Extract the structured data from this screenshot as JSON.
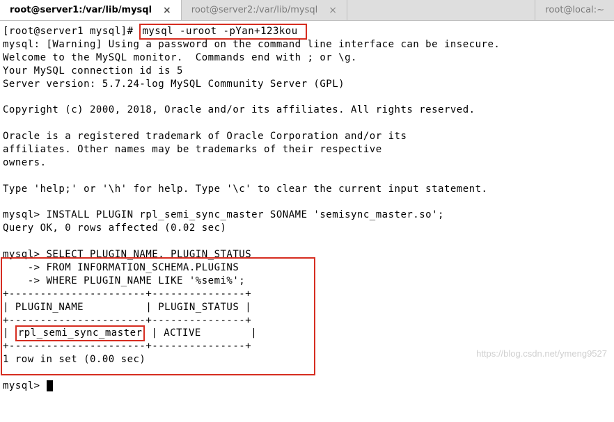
{
  "tabs": {
    "t1": "root@server1:/var/lib/mysql",
    "t2": "root@server2:/var/lib/mysql",
    "t3": "root@local:~"
  },
  "term": {
    "prompt_prefix": "[root@server1 mysql]# ",
    "cmd1": "mysql -uroot -pYan+123kou ",
    "l1": "mysql: [Warning] Using a password on the command line interface can be insecure.",
    "l2": "Welcome to the MySQL monitor.  Commands end with ; or \\g.",
    "l3": "Your MySQL connection id is 5",
    "l4": "Server version: 5.7.24-log MySQL Community Server (GPL)",
    "l5": "Copyright (c) 2000, 2018, Oracle and/or its affiliates. All rights reserved.",
    "l6": "Oracle is a registered trademark of Oracle Corporation and/or its",
    "l7": "affiliates. Other names may be trademarks of their respective",
    "l8": "owners.",
    "l9": "Type 'help;' or '\\h' for help. Type '\\c' to clear the current input statement.",
    "l10": "mysql> INSTALL PLUGIN rpl_semi_sync_master SONAME 'semisync_master.so';",
    "l11": "Query OK, 0 rows affected (0.02 sec)",
    "q1": "mysql> SELECT PLUGIN_NAME, PLUGIN_STATUS",
    "q2": "    -> FROM INFORMATION_SCHEMA.PLUGINS",
    "q3": "    -> WHERE PLUGIN_NAME LIKE '%semi%';",
    "sep": "+----------------------+---------------+",
    "hdr": "| PLUGIN_NAME          | PLUGIN_STATUS |",
    "row_pre": "| ",
    "row_plugin": "rpl_semi_sync_master",
    "row_post": " | ACTIVE        |",
    "foot": "1 row in set (0.00 sec)",
    "prompt2": "mysql> "
  },
  "watermark": "https://blog.csdn.net/ymeng9527"
}
